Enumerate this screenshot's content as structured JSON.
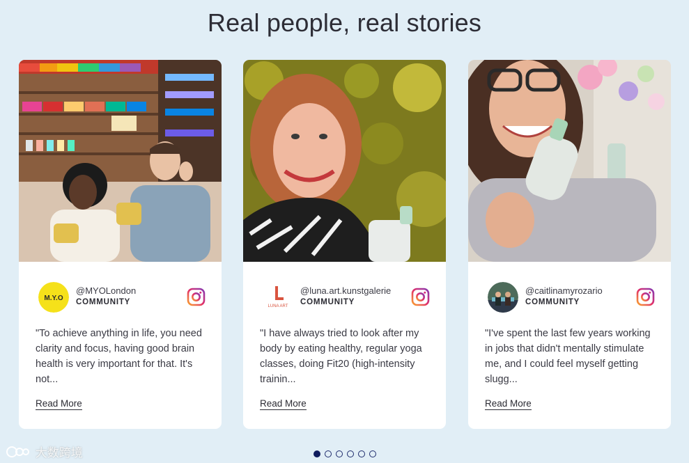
{
  "heading": "Real people, real stories",
  "cards": [
    {
      "handle": "@MYOLondon",
      "role": "COMMUNITY",
      "avatar_text": "M.Y.O",
      "quote": "\"To achieve anything in life, you need clarity and focus, having good brain health is very important for that. It's not...",
      "read_more": "Read More",
      "photo_desc_icon": "photo-couple-shop"
    },
    {
      "handle": "@luna.art.kunstgalerie",
      "role": "COMMUNITY",
      "avatar_text": "LUNA ART",
      "quote": "\"I have always tried to look after my body by eating healthy, regular yoga classes, doing Fit20 (high-intensity trainin...",
      "read_more": "Read More",
      "photo_desc_icon": "photo-woman-hedge"
    },
    {
      "handle": "@caitlinamyrozario",
      "role": "COMMUNITY",
      "avatar_text": "",
      "quote": "\"I've spent the last few years working in jobs that didn't mentally stimulate me, and I could feel myself getting slugg...",
      "read_more": "Read More",
      "photo_desc_icon": "photo-woman-selfie"
    }
  ],
  "pagination": {
    "count": 6,
    "active": 0
  },
  "watermark": "大数跨境",
  "colors": {
    "background": "#e1eef6",
    "card": "#ffffff",
    "dot_active": "#0f1c5e",
    "myo_yellow": "#f5e11a",
    "luna_red": "#d9543f"
  }
}
